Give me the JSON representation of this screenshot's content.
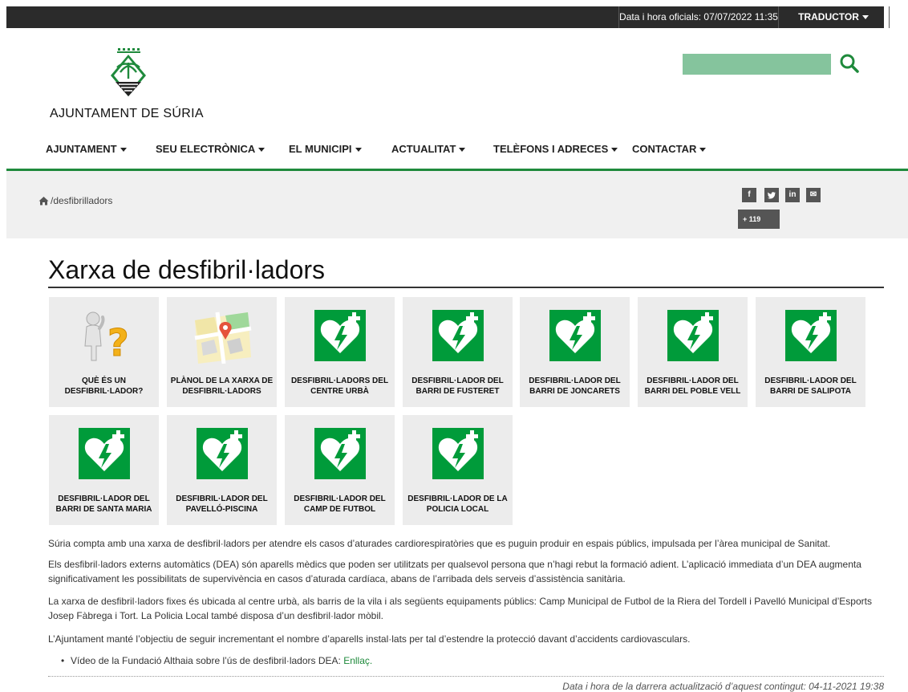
{
  "topbar": {
    "datetime": "Data i hora oficials: 07/07/2022 11:35",
    "translator": "TRADUCTOR"
  },
  "header": {
    "logo_text": "AJUNTAMENT DE SÚRIA",
    "search_placeholder": ""
  },
  "nav": [
    {
      "label": "AJUNTAMENT"
    },
    {
      "label": "SEU ELECTRÒNICA"
    },
    {
      "label": "EL MUNICIPI"
    },
    {
      "label": "ACTUALITAT"
    },
    {
      "label": "TELÈFONS I ADRECES"
    },
    {
      "label": "CONTACTAR"
    }
  ],
  "breadcrumb": {
    "path": "/desfibrilladors"
  },
  "share": {
    "facebook": "f",
    "twitter": "t",
    "linkedin": "in",
    "email": "✉",
    "count": "+ 119"
  },
  "page": {
    "title": "Xarxa de desfibril·ladors"
  },
  "tiles": [
    {
      "label": "QUÈ ÉS UN DESFIBRIL·LADOR?",
      "icon": "question-person-icon"
    },
    {
      "label": "PLÀNOL DE LA XARXA DE DESFIBRIL·LADORS",
      "icon": "map-pin-icon"
    },
    {
      "label": "DESFIBRIL·LADORS DEL CENTRE URBÀ",
      "icon": "aed-heart-icon"
    },
    {
      "label": "DESFIBRIL·LADOR DEL BARRI DE FUSTERET",
      "icon": "aed-heart-icon"
    },
    {
      "label": "DESFIBRIL·LADOR DEL BARRI DE JONCARETS",
      "icon": "aed-heart-icon"
    },
    {
      "label": "DESFIBRIL·LADOR DEL BARRI DEL POBLE VELL",
      "icon": "aed-heart-icon"
    },
    {
      "label": "DESFIBRIL·LADOR DEL BARRI DE SALIPOTA",
      "icon": "aed-heart-icon"
    },
    {
      "label": "DESFIBRIL·LADOR DEL BARRI DE SANTA MARIA",
      "icon": "aed-heart-icon"
    },
    {
      "label": "DESFIBRIL·LADOR DEL PAVELLÓ-PISCINA",
      "icon": "aed-heart-icon"
    },
    {
      "label": "DESFIBRIL·LADOR DEL CAMP DE FUTBOL",
      "icon": "aed-heart-icon"
    },
    {
      "label": "DESFIBRIL·LADOR DE LA POLICIA LOCAL",
      "icon": "aed-heart-icon"
    }
  ],
  "paragraphs": [
    "Súria compta amb una xarxa de desfibril·ladors per atendre els casos d’aturades cardiorespiratòries que es puguin produir en espais públics, impulsada per l’àrea municipal de Sanitat.",
    "Els desfibril·ladors externs automàtics (DEA) són aparells mèdics que poden ser utilitzats per qualsevol persona que n’hagi rebut la formació adient. L’aplicació immediata d’un DEA augmenta significativament les possibilitats de supervivència en casos d’aturada cardíaca, abans de l’arribada dels serveis d’assistència sanitària.",
    "La xarxa de desfibril·ladors fixes és ubicada al centre urbà, als barris de la vila i als següents equipaments públics: Camp Municipal de Futbol de la Riera del Tordell i Pavelló Municipal d’Esports Josep Fàbrega i Tort. La Policia Local també disposa d’un desfibril·lador mòbil.",
    "L’Ajuntament manté l’objectiu de seguir incrementant el nombre d’aparells instal·lats per tal d’estendre la protecció davant d’accidents cardiovasculars."
  ],
  "bullet": {
    "text": "Vídeo de la Fundació Althaia sobre l’ús de desfibril·ladors DEA: ",
    "link": "Enllaç."
  },
  "footer": {
    "last_update": "Data i hora de la darrera actualització d’aquest contingut: 04-11-2021 19:38"
  },
  "colors": {
    "accent_green": "#1f8a3c",
    "aed_green": "#009b3a",
    "search_bg": "#85c49d",
    "topbar": "#2b2b2b"
  }
}
